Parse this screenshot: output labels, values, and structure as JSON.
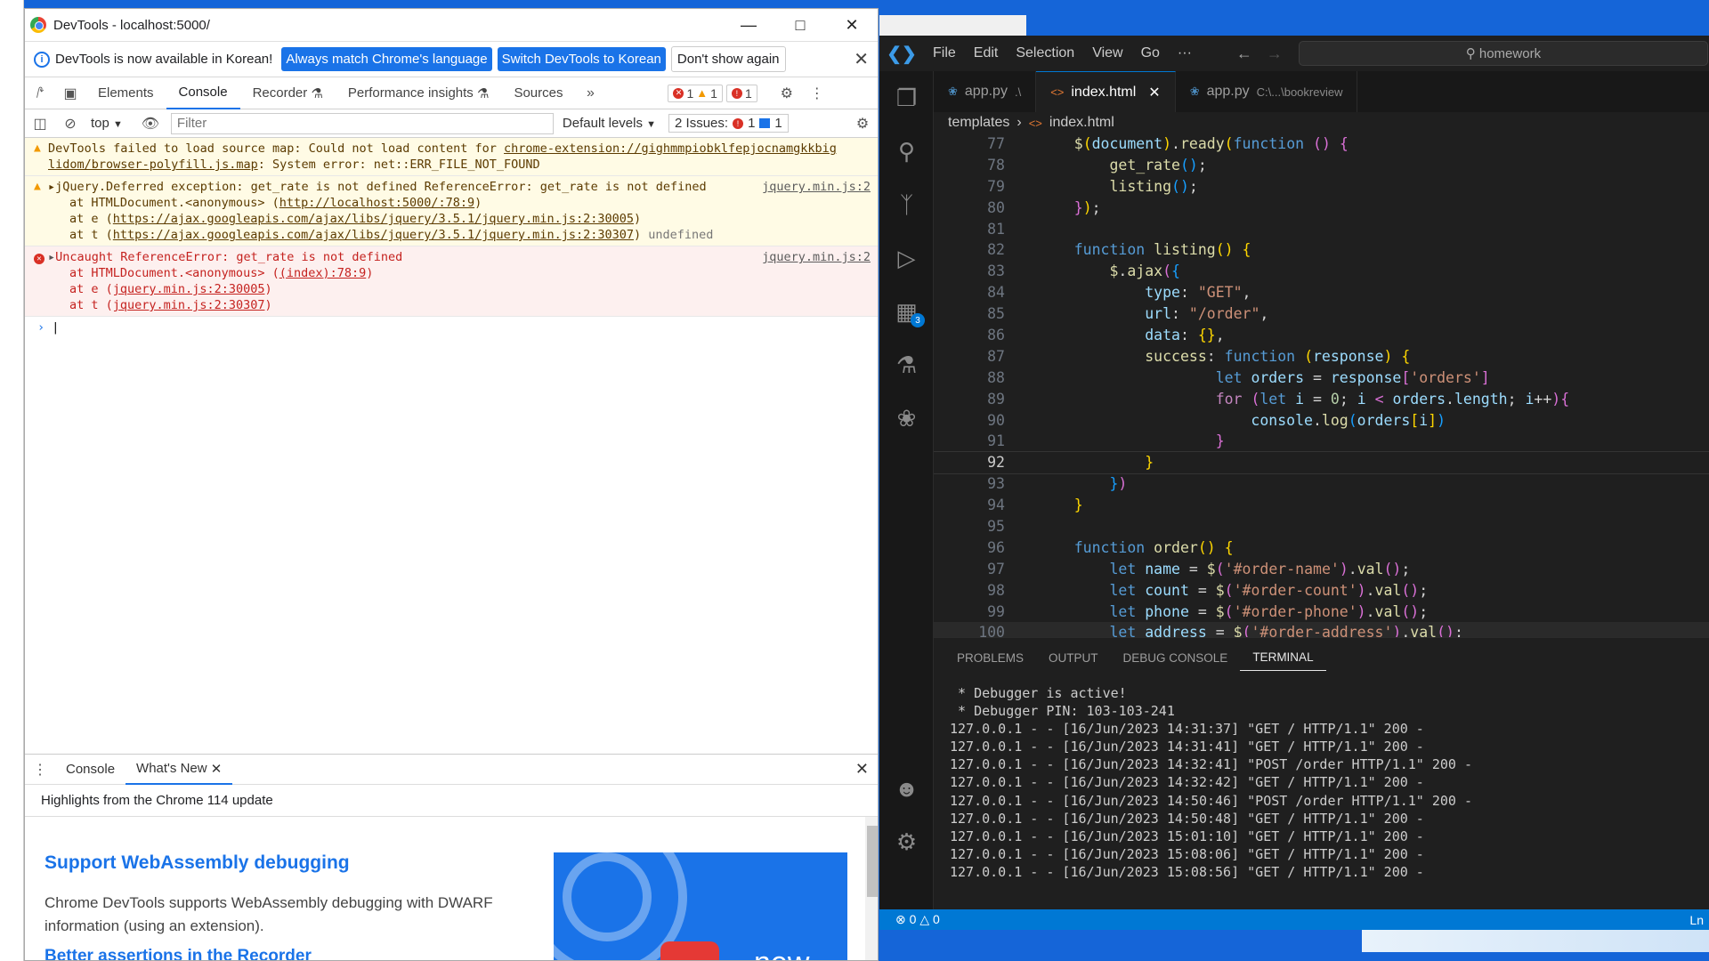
{
  "devtools": {
    "title": "DevTools - localhost:5000/",
    "infobar": {
      "text": "DevTools is now available in Korean!",
      "btn_match": "Always match Chrome's language",
      "btn_switch": "Switch DevTools to Korean",
      "btn_dont_show": "Don't show again"
    },
    "tabs": [
      "Elements",
      "Console",
      "Recorder",
      "Performance insights",
      "Sources"
    ],
    "counts": {
      "errors": "1",
      "warnings": "1",
      "issues": "1"
    },
    "filterbar": {
      "context": "top",
      "filter_placeholder": "Filter",
      "levels": "Default levels",
      "issues_label": "2 Issues:",
      "issues_err": "1",
      "issues_info": "1"
    },
    "messages": {
      "m1_l1": "DevTools failed to load source map: Could not load content for ",
      "m1_link": "chrome-extension://gighmmpiobklfepjocnamgkkbig",
      "m1_link2": "lidom/browser-polyfill.js.map",
      "m1_l2_rest": ": System error: net::ERR_FILE_NOT_FOUND",
      "m2_l1": "jQuery.Deferred exception: get_rate is not defined ReferenceError: get_rate is not defined",
      "m2_src": "jquery.min.js:2",
      "m2_l2a": "at HTMLDocument.<anonymous> (",
      "m2_l2link": "http://localhost:5000/:78:9",
      "m2_l3a": "at e (",
      "m2_l3link": "https://ajax.googleapis.com/ajax/libs/jquery/3.5.1/jquery.min.js:2:30005",
      "m2_l4a": "at t (",
      "m2_l4link": "https://ajax.googleapis.com/ajax/libs/jquery/3.5.1/jquery.min.js:2:30307",
      "m2_l4b": "undefined",
      "m3_l1": "Uncaught ReferenceError: get_rate is not defined",
      "m3_src": "jquery.min.js:2",
      "m3_l2a": "at HTMLDocument.<anonymous> (",
      "m3_l2link": "(index):78:9",
      "m3_l3a": "at e (",
      "m3_l3link": "jquery.min.js:2:30005",
      "m3_l4a": "at t (",
      "m3_l4link": "jquery.min.js:2:30307"
    },
    "drawer": {
      "tab_console": "Console",
      "tab_whatsnew": "What's New",
      "highlights": "Highlights from the Chrome 114 update",
      "h1": "Support WebAssembly debugging",
      "body": "Chrome DevTools supports WebAssembly debugging with DWARF information (using an extension).",
      "h2": "Better assertions in the Recorder",
      "image_text": "new"
    }
  },
  "vscode": {
    "menu": [
      "File",
      "Edit",
      "Selection",
      "View",
      "Go",
      "···"
    ],
    "search": "homework",
    "tabs": [
      {
        "label": "app.py",
        "desc": ".\\"
      },
      {
        "label": "index.html",
        "desc": ""
      },
      {
        "label": "app.py",
        "desc": "C:\\...\\bookreview"
      }
    ],
    "breadcrumb": {
      "folder": "templates",
      "file": "index.html"
    },
    "activity_badge": "3",
    "panel_tabs": [
      "PROBLEMS",
      "OUTPUT",
      "DEBUG CONSOLE",
      "TERMINAL"
    ],
    "terminal": [
      " * Debugger is active!",
      " * Debugger PIN: 103-103-241",
      "127.0.0.1 - - [16/Jun/2023 14:31:37] \"GET / HTTP/1.1\" 200 -",
      "127.0.0.1 - - [16/Jun/2023 14:31:41] \"GET / HTTP/1.1\" 200 -",
      "127.0.0.1 - - [16/Jun/2023 14:32:41] \"POST /order HTTP/1.1\" 200 -",
      "127.0.0.1 - - [16/Jun/2023 14:32:42] \"GET / HTTP/1.1\" 200 -",
      "127.0.0.1 - - [16/Jun/2023 14:50:46] \"POST /order HTTP/1.1\" 200 -",
      "127.0.0.1 - - [16/Jun/2023 14:50:48] \"GET / HTTP/1.1\" 200 -",
      "127.0.0.1 - - [16/Jun/2023 15:01:10] \"GET / HTTP/1.1\" 200 -",
      "127.0.0.1 - - [16/Jun/2023 15:08:06] \"GET / HTTP/1.1\" 200 -",
      "127.0.0.1 - - [16/Jun/2023 15:08:56] \"GET / HTTP/1.1\" 200 -"
    ],
    "status": {
      "errors": "0",
      "warnings": "0",
      "right": "Ln"
    },
    "line_numbers": [
      "77",
      "78",
      "79",
      "80",
      "81",
      "82",
      "83",
      "84",
      "85",
      "86",
      "87",
      "88",
      "89",
      "90",
      "91",
      "92",
      "93",
      "94",
      "95",
      "96",
      "97",
      "98",
      "99",
      "100"
    ]
  }
}
